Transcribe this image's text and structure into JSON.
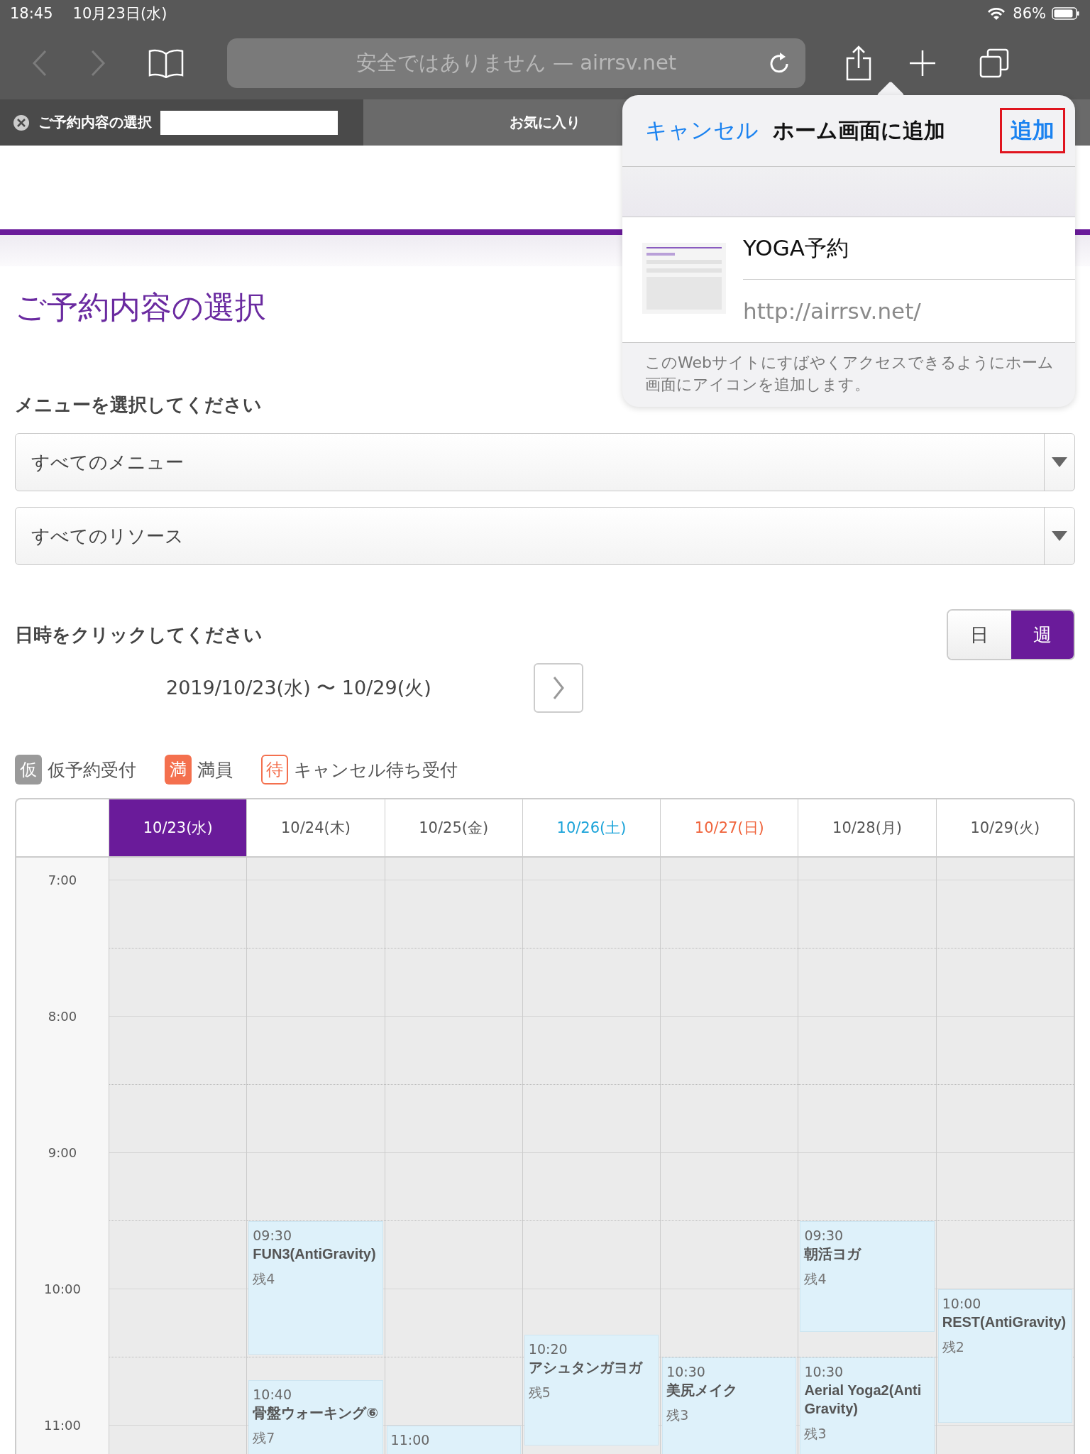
{
  "status_bar": {
    "time": "18:45",
    "date": "10月23日(水)",
    "battery": "86%"
  },
  "browser": {
    "address": "安全ではありません — airrsv.net"
  },
  "tabs": [
    {
      "label": "ご予約内容の選択",
      "selected": true
    },
    {
      "label": "お気に入り",
      "selected": false
    }
  ],
  "add_to_home_popup": {
    "cancel": "キャンセル",
    "title": "ホーム画面に追加",
    "add": "追加",
    "name": "YOGA予約",
    "url": "http://airrsv.net/",
    "note": "このWebサイトにすばやくアクセスできるようにホーム画面にアイコンを追加します。"
  },
  "page": {
    "title": "ご予約内容の選択",
    "menu_label": "メニューを選択してください",
    "selects": [
      {
        "value": "すべてのメニュー"
      },
      {
        "value": "すべてのリソース"
      }
    ],
    "date_label": "日時をクリックしてください",
    "view_toggle": [
      {
        "label": "日",
        "selected": false
      },
      {
        "label": "週",
        "selected": true
      }
    ],
    "date_range": "2019/10/23(水) 〜 10/29(火)",
    "legend": [
      {
        "kind": "tentative",
        "badge": "仮",
        "label": "仮予約受付"
      },
      {
        "kind": "full",
        "badge": "満",
        "label": "満員"
      },
      {
        "kind": "waitlist",
        "badge": "待",
        "label": "キャンセル待ち受付"
      }
    ]
  },
  "calendar": {
    "times": [
      "7:00",
      "8:00",
      "9:00",
      "10:00",
      "11:00"
    ],
    "days": [
      {
        "label": "10/23(水)",
        "selected": true
      },
      {
        "label": "10/24(木)",
        "selected": false,
        "color": "#555555",
        "events": [
          {
            "time": "09:30",
            "title": "FUN3(AntiGravity)",
            "remaining": "残4"
          },
          {
            "time": "10:40",
            "title": "骨盤ウォーキング⑥",
            "remaining": "残7"
          }
        ]
      },
      {
        "label": "10/25(金)",
        "selected": false,
        "color": "#555555",
        "events": [
          {
            "time": "11:00"
          }
        ]
      },
      {
        "label": "10/26(土)",
        "selected": false,
        "color": "#1aa3d9",
        "events": [
          {
            "time": "10:20",
            "title": "アシュタンガヨガ",
            "remaining": "残5"
          }
        ]
      },
      {
        "label": "10/27(日)",
        "selected": false,
        "color": "#f0643c",
        "events": [
          {
            "time": "10:30",
            "title": "美尻メイク",
            "remaining": "残3"
          }
        ]
      },
      {
        "label": "10/28(月)",
        "selected": false,
        "color": "#555555",
        "events": [
          {
            "time": "09:30",
            "title": "朝活ヨガ",
            "remaining": "残4"
          },
          {
            "time": "10:30",
            "title": "Aerial Yoga2(AntiGravity)",
            "remaining": "残3"
          }
        ]
      },
      {
        "label": "10/29(火)",
        "selected": false,
        "color": "#555555",
        "events": [
          {
            "time": "10:00",
            "title": "REST(AntiGravity)",
            "remaining": "残2"
          }
        ]
      }
    ]
  }
}
